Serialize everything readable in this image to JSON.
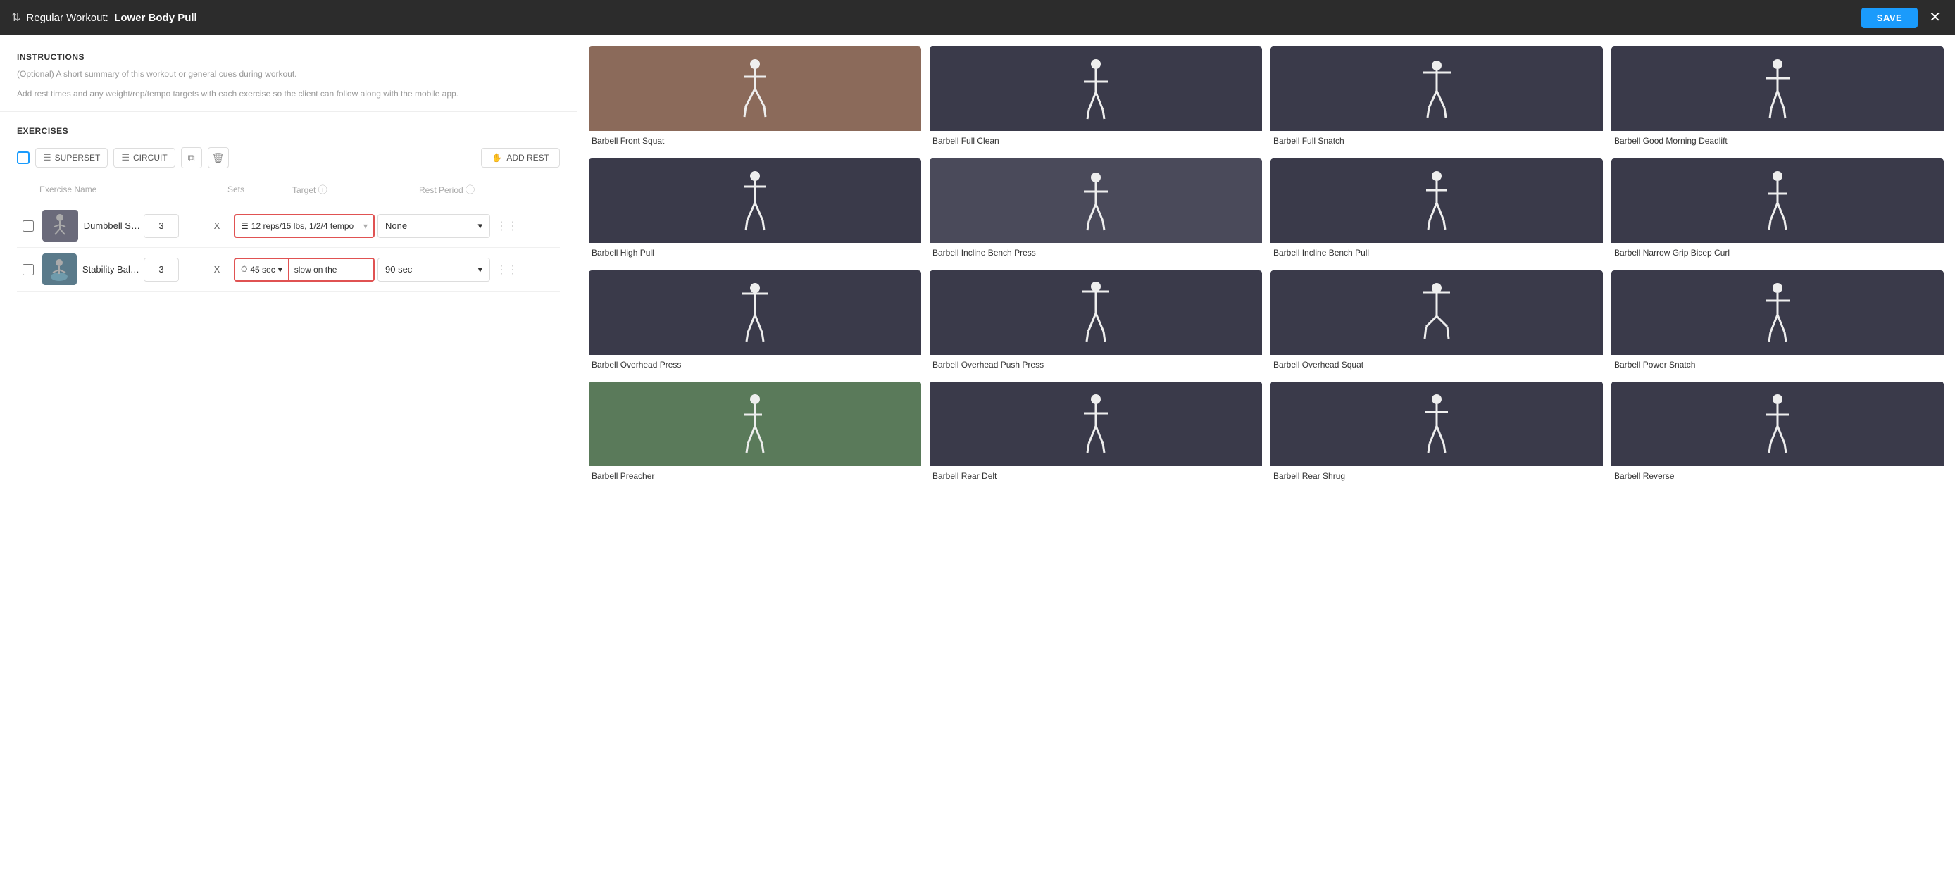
{
  "header": {
    "workout_type": "Regular Workout:",
    "workout_name": "Lower Body Pull",
    "save_label": "SAVE",
    "close_icon": "✕",
    "sort_icon": "⇅"
  },
  "left_panel": {
    "instructions": {
      "title": "INSTRUCTIONS",
      "hint1": "(Optional) A short summary of this workout or general cues during workout.",
      "hint2": "Add rest times and any weight/rep/tempo targets with each exercise so the client can follow along with the mobile app."
    },
    "exercises": {
      "title": "EXERCISES",
      "toolbar": {
        "superset_label": "SUPERSET",
        "circuit_label": "CIRCUIT",
        "add_rest_label": "ADD REST"
      },
      "col_headers": {
        "exercise_name": "Exercise Name",
        "sets": "Sets",
        "target": "Target",
        "rest_period": "Rest Period"
      },
      "rows": [
        {
          "name": "Dumbbell Strai...",
          "sets": "3",
          "target_value": "12 reps/15 lbs, 1/2/4 tempo",
          "rest": "None",
          "thumb_type": "dumbbell"
        },
        {
          "name": "Stability Ball Ha...",
          "sets": "3",
          "target_duration": "45 sec",
          "target_note": "slow on the",
          "rest": "90 sec",
          "thumb_type": "stability"
        }
      ]
    }
  },
  "right_panel": {
    "exercise_cards": [
      {
        "id": "barbell-front-squat",
        "label": "Barbell Front Squat",
        "img_type": "brick"
      },
      {
        "id": "barbell-full-clean",
        "label": "Barbell Full Clean",
        "img_type": "dark"
      },
      {
        "id": "barbell-full-snatch",
        "label": "Barbell Full Snatch",
        "img_type": "dark"
      },
      {
        "id": "barbell-good-morning",
        "label": "Barbell Good Morning Deadlift",
        "img_type": "dark"
      },
      {
        "id": "barbell-high-pull",
        "label": "Barbell High Pull",
        "img_type": "dark"
      },
      {
        "id": "barbell-incline-bench-press",
        "label": "Barbell Incline Bench Press",
        "img_type": "gym"
      },
      {
        "id": "barbell-incline-bench-pull",
        "label": "Barbell Incline Bench Pull",
        "img_type": "dark"
      },
      {
        "id": "barbell-narrow-grip-bicep-curl",
        "label": "Barbell Narrow Grip Bicep Curl",
        "img_type": "dark"
      },
      {
        "id": "barbell-overhead-press",
        "label": "Barbell Overhead Press",
        "img_type": "dark"
      },
      {
        "id": "barbell-overhead-push-press",
        "label": "Barbell Overhead Push Press",
        "img_type": "dark"
      },
      {
        "id": "barbell-overhead-squat",
        "label": "Barbell Overhead Squat",
        "img_type": "dark"
      },
      {
        "id": "barbell-power-snatch",
        "label": "Barbell Power Snatch",
        "img_type": "dark"
      },
      {
        "id": "barbell-preacher",
        "label": "Barbell Preacher",
        "img_type": "outdoor"
      },
      {
        "id": "barbell-rear-delt",
        "label": "Barbell Rear Delt",
        "img_type": "dark"
      },
      {
        "id": "barbell-rear-shrug",
        "label": "Barbell Rear Shrug",
        "img_type": "dark"
      },
      {
        "id": "barbell-reverse",
        "label": "Barbell Reverse",
        "img_type": "dark"
      }
    ]
  }
}
